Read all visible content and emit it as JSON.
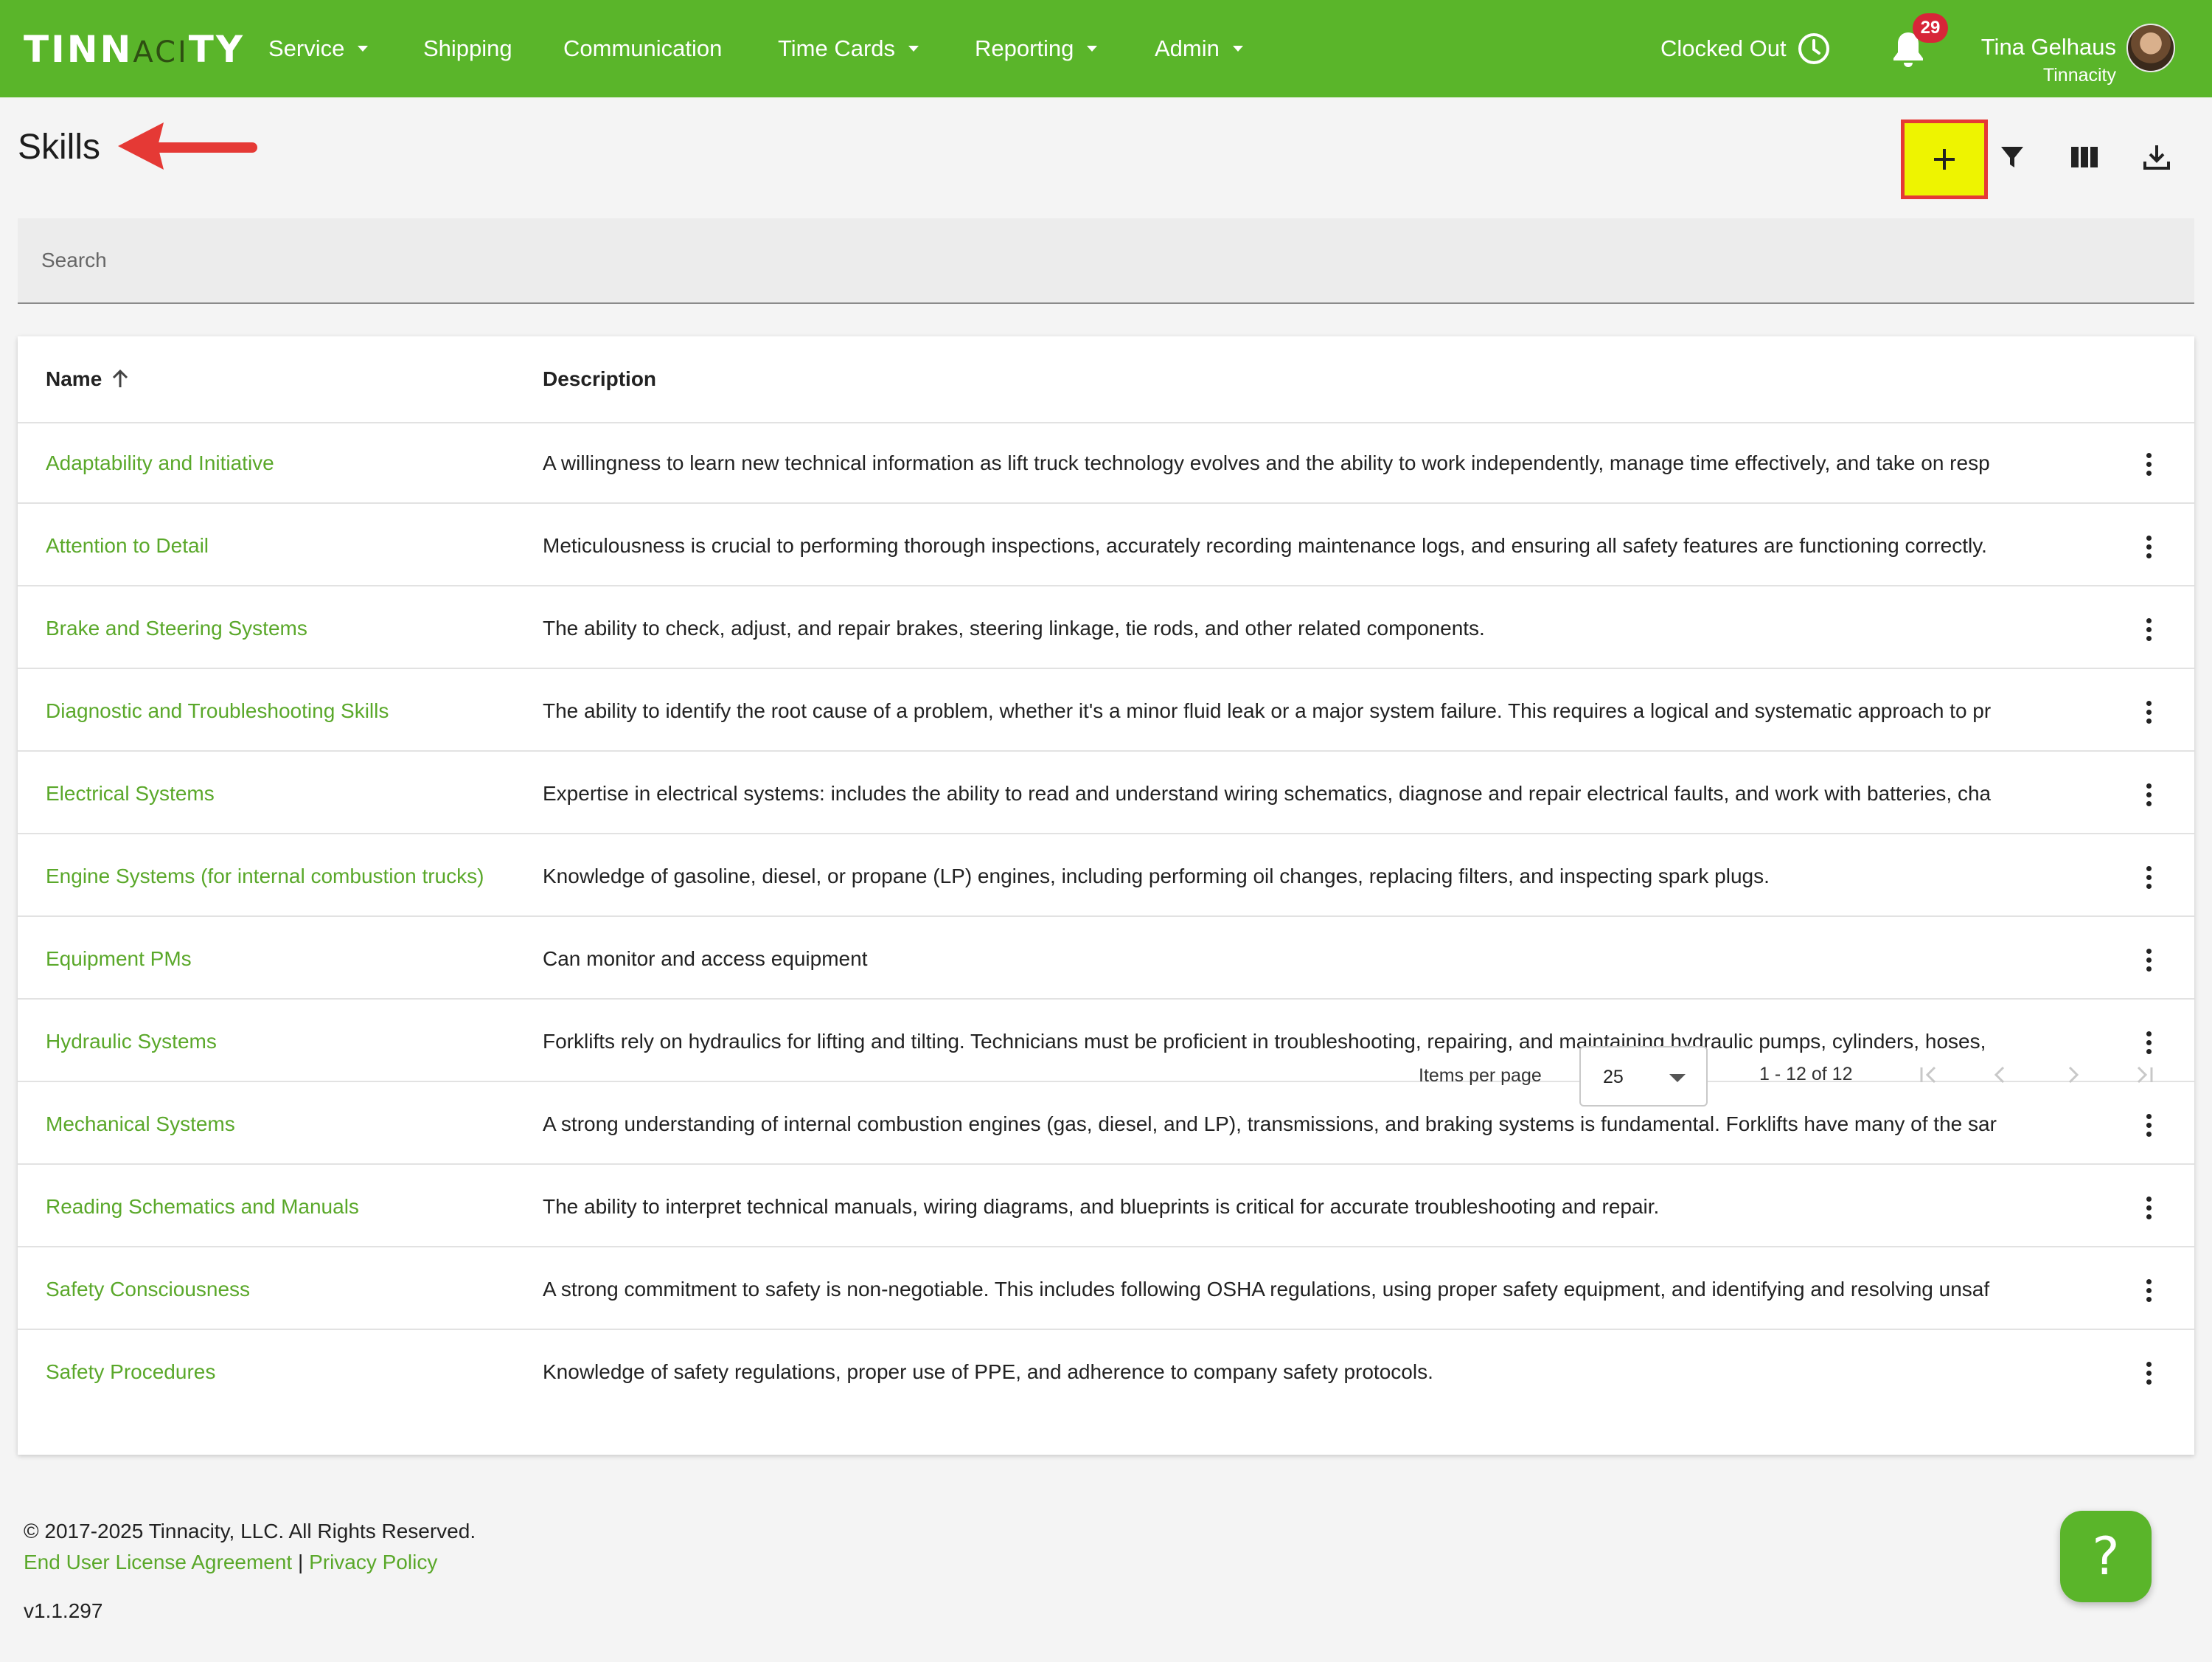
{
  "colors": {
    "brand": "#5ab52a",
    "link": "#5aa82a",
    "highlight": "#eef400",
    "annotation": "#e53935",
    "badge": "#d72638"
  },
  "logo": {
    "text": "TINNACITY"
  },
  "nav": {
    "items": [
      {
        "label": "Service",
        "dropdown": true
      },
      {
        "label": "Shipping",
        "dropdown": false
      },
      {
        "label": "Communication",
        "dropdown": false
      },
      {
        "label": "Time Cards",
        "dropdown": true
      },
      {
        "label": "Reporting",
        "dropdown": true
      },
      {
        "label": "Admin",
        "dropdown": true
      }
    ],
    "clock_status": "Clocked Out",
    "clock_icon": "clock-icon",
    "notification_count": "29",
    "user_name": "Tina Gelhaus",
    "user_org": "Tinnacity"
  },
  "page": {
    "title": "Skills",
    "toolbar": {
      "add_icon": "plus-icon",
      "filter_icon": "filter-icon",
      "columns_icon": "columns-icon",
      "download_icon": "download-icon"
    }
  },
  "search": {
    "placeholder": "Search",
    "value": ""
  },
  "table": {
    "columns": [
      {
        "label": "Name",
        "sort": "asc"
      },
      {
        "label": "Description"
      }
    ],
    "rows": [
      {
        "name": "Adaptability and Initiative",
        "description": "A willingness to learn new technical information as lift truck technology evolves and the ability to work independently, manage time effectively, and take on resp"
      },
      {
        "name": "Attention to Detail",
        "description": "Meticulousness is crucial to performing thorough inspections, accurately recording maintenance logs, and ensuring all safety features are functioning correctly."
      },
      {
        "name": "Brake and Steering Systems",
        "description": "The ability to check, adjust, and repair brakes, steering linkage, tie rods, and other related components."
      },
      {
        "name": "Diagnostic and Troubleshooting Skills",
        "description": "The ability to identify the root cause of a problem, whether it's a minor fluid leak or a major system failure. This requires a logical and systematic approach to pr"
      },
      {
        "name": "Electrical Systems",
        "description": "Expertise in electrical systems: includes the ability to read and understand wiring schematics, diagnose and repair electrical faults, and work with batteries, cha"
      },
      {
        "name": "Engine Systems (for internal combustion trucks)",
        "description": "Knowledge of gasoline, diesel, or propane (LP) engines, including performing oil changes, replacing filters, and inspecting spark plugs."
      },
      {
        "name": "Equipment PMs",
        "description": "Can monitor and access equipment"
      },
      {
        "name": "Hydraulic Systems",
        "description": "Forklifts rely on hydraulics for lifting and tilting. Technicians must be proficient in troubleshooting, repairing, and maintaining hydraulic pumps, cylinders, hoses,"
      },
      {
        "name": "Mechanical Systems",
        "description": "A strong understanding of internal combustion engines (gas, diesel, and LP), transmissions, and braking systems is fundamental. Forklifts have many of the sar"
      },
      {
        "name": "Reading Schematics and Manuals",
        "description": "The ability to interpret technical manuals, wiring diagrams, and blueprints is critical for accurate troubleshooting and repair."
      },
      {
        "name": "Safety Consciousness",
        "description": "A strong commitment to safety is non-negotiable. This includes following OSHA regulations, using proper safety equipment, and identifying and resolving unsaf"
      },
      {
        "name": "Safety Procedures",
        "description": "Knowledge of safety regulations, proper use of PPE, and adherence to company safety protocols."
      }
    ],
    "row_menu_icon": "more-vert-icon"
  },
  "paginator": {
    "items_per_page_label": "Items per page",
    "items_per_page": "25",
    "range": "1 - 12 of 12"
  },
  "footer": {
    "copyright": "© 2017-2025 Tinnacity, LLC. All Rights Reserved.",
    "eula": "End User License Agreement",
    "separator": "|",
    "privacy": "Privacy Policy",
    "version": "v1.1.297",
    "help_label": "?"
  }
}
